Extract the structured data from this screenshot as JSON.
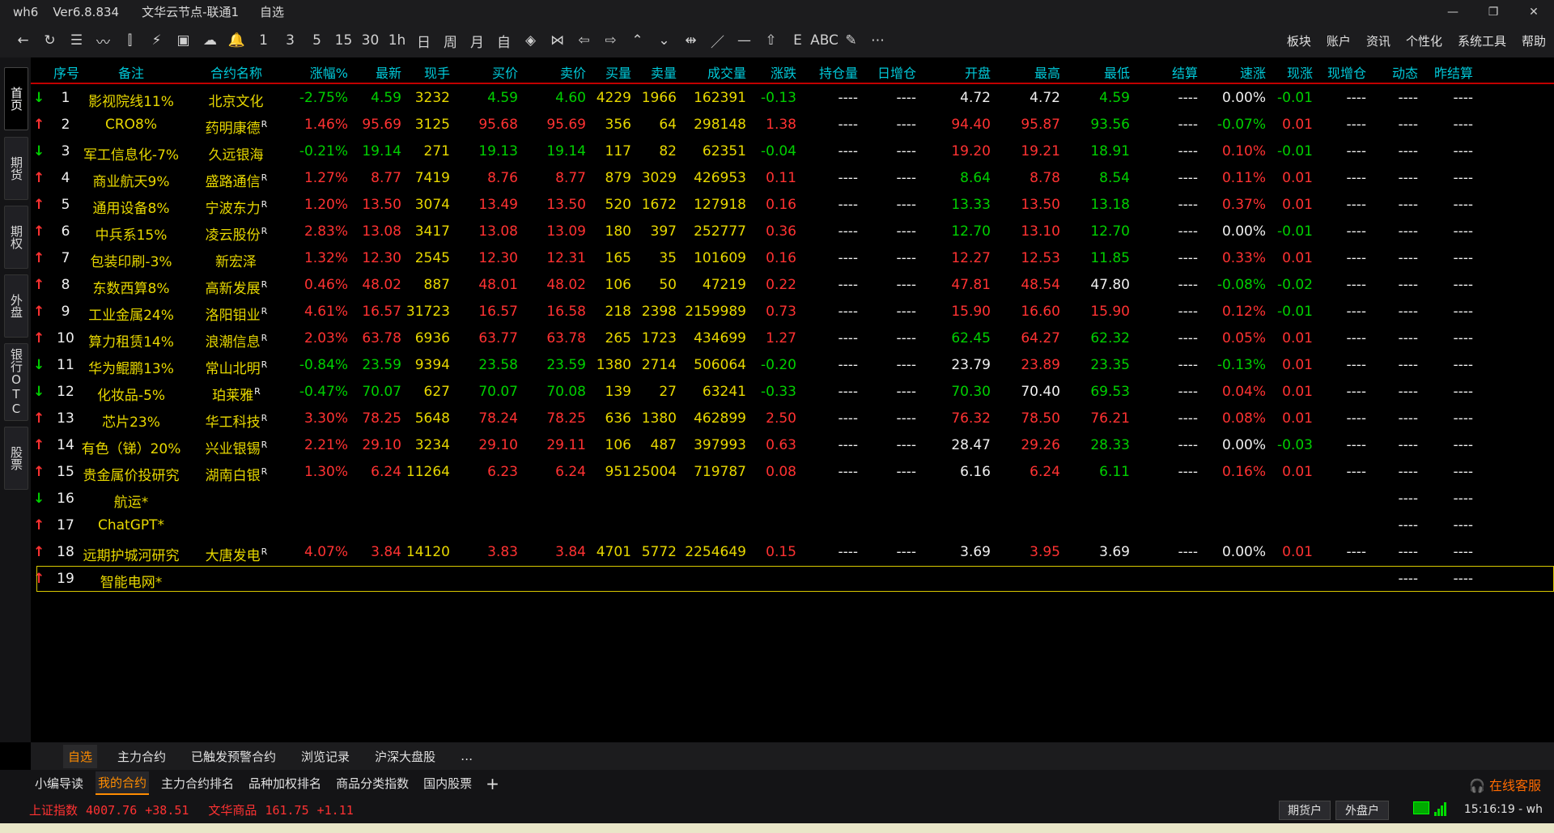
{
  "window": {
    "app": "wh6",
    "version": "Ver6.8.834",
    "node": "文华云节点-联通1",
    "page": "自选"
  },
  "toolbar": {
    "icons": [
      "back-icon",
      "refresh-icon",
      "list-icon",
      "line-chart-icon",
      "candlestick-icon",
      "lightning-chart-icon",
      "kline-box-icon",
      "cloud-lightning-icon",
      "bell-icon",
      "1",
      "3",
      "5",
      "15",
      "30",
      "1h",
      "日",
      "周",
      "月",
      "自",
      "diamond-left-icon",
      "diamond-right-icon",
      "arrow-left-icon",
      "arrow-right-icon",
      "double-up-icon",
      "double-down-icon",
      "expand-icon",
      "slash-icon",
      "dash-icon",
      "home-up-icon",
      "text-e-icon",
      "ABC",
      "pen-icon",
      "more-icon"
    ],
    "glyphs": [
      "←",
      "↻",
      "☰",
      "〰",
      "⫿",
      "⚡",
      "▣",
      "☁",
      "🔔",
      "1",
      "3",
      "5",
      "15",
      "30",
      "1h",
      "日",
      "周",
      "月",
      "自",
      "◈",
      "⋈",
      "⇦",
      "⇨",
      "⌃",
      "⌄",
      "⇹",
      "／",
      "—",
      "⇧",
      "E",
      "ABC",
      "✎",
      "⋯"
    ],
    "menu": [
      "板块",
      "账户",
      "资讯",
      "个性化",
      "系统工具",
      "帮助"
    ]
  },
  "left_tabs": [
    "首页",
    "期货",
    "期权",
    "外盘",
    "银行OTC",
    "股票"
  ],
  "table": {
    "headers": [
      "序号",
      "备注",
      "合约名称",
      "涨幅%",
      "最新",
      "现手",
      "买价",
      "卖价",
      "买量",
      "卖量",
      "成交量",
      "涨跌",
      "持仓量",
      "日增仓",
      "开盘",
      "最高",
      "最低",
      "结算",
      "速涨",
      "现涨",
      "现增仓",
      "动态",
      "昨结算"
    ],
    "rows": [
      {
        "dir": "down",
        "no": "1",
        "note": "影视院线11%",
        "name": "北京文化",
        "r": "",
        "chg_pct": "-2.75%",
        "last": "4.59",
        "cur": "3232",
        "bid": "4.59",
        "ask": "4.60",
        "bid_vol": "4229",
        "ask_vol": "1966",
        "vol": "162391",
        "chg": "-0.13",
        "oi": "----",
        "oi_chg": "----",
        "open": "4.72",
        "high": "4.72",
        "low": "4.59",
        "settle": "----",
        "speed": "0.00%",
        "cur_chg": "-0.01",
        "cur_oi": "----",
        "dyn": "----",
        "prev": "----",
        "color": "green",
        "open_c": "white",
        "high_c": "white",
        "low_c": "green",
        "speed_c": "white",
        "curchg_c": "green"
      },
      {
        "dir": "up",
        "no": "2",
        "note": "CRO8%",
        "name": "药明康德",
        "r": "R",
        "chg_pct": "1.46%",
        "last": "95.69",
        "cur": "3125",
        "bid": "95.68",
        "ask": "95.69",
        "bid_vol": "356",
        "ask_vol": "64",
        "vol": "298148",
        "chg": "1.38",
        "oi": "----",
        "oi_chg": "----",
        "open": "94.40",
        "high": "95.87",
        "low": "93.56",
        "settle": "----",
        "speed": "-0.07%",
        "cur_chg": "0.01",
        "cur_oi": "----",
        "dyn": "----",
        "prev": "----",
        "color": "red",
        "open_c": "red",
        "high_c": "red",
        "low_c": "green",
        "speed_c": "green",
        "curchg_c": "red"
      },
      {
        "dir": "down",
        "no": "3",
        "note": "军工信息化-7%",
        "name": "久远银海",
        "r": "",
        "chg_pct": "-0.21%",
        "last": "19.14",
        "cur": "271",
        "bid": "19.13",
        "ask": "19.14",
        "bid_vol": "117",
        "ask_vol": "82",
        "vol": "62351",
        "chg": "-0.04",
        "oi": "----",
        "oi_chg": "----",
        "open": "19.20",
        "high": "19.21",
        "low": "18.91",
        "settle": "----",
        "speed": "0.10%",
        "cur_chg": "-0.01",
        "cur_oi": "----",
        "dyn": "----",
        "prev": "----",
        "color": "green",
        "open_c": "red",
        "high_c": "red",
        "low_c": "green",
        "speed_c": "red",
        "curchg_c": "green"
      },
      {
        "dir": "up",
        "no": "4",
        "note": "商业航天9%",
        "name": "盛路通信",
        "r": "R",
        "chg_pct": "1.27%",
        "last": "8.77",
        "cur": "7419",
        "bid": "8.76",
        "ask": "8.77",
        "bid_vol": "879",
        "ask_vol": "3029",
        "vol": "426953",
        "chg": "0.11",
        "oi": "----",
        "oi_chg": "----",
        "open": "8.64",
        "high": "8.78",
        "low": "8.54",
        "settle": "----",
        "speed": "0.11%",
        "cur_chg": "0.01",
        "cur_oi": "----",
        "dyn": "----",
        "prev": "----",
        "color": "red",
        "open_c": "green",
        "high_c": "red",
        "low_c": "green",
        "speed_c": "red",
        "curchg_c": "red"
      },
      {
        "dir": "up",
        "no": "5",
        "note": "通用设备8%",
        "name": "宁波东力",
        "r": "R",
        "chg_pct": "1.20%",
        "last": "13.50",
        "cur": "3074",
        "bid": "13.49",
        "ask": "13.50",
        "bid_vol": "520",
        "ask_vol": "1672",
        "vol": "127918",
        "chg": "0.16",
        "oi": "----",
        "oi_chg": "----",
        "open": "13.33",
        "high": "13.50",
        "low": "13.18",
        "settle": "----",
        "speed": "0.37%",
        "cur_chg": "0.01",
        "cur_oi": "----",
        "dyn": "----",
        "prev": "----",
        "color": "red",
        "open_c": "green",
        "high_c": "red",
        "low_c": "green",
        "speed_c": "red",
        "curchg_c": "red"
      },
      {
        "dir": "up",
        "no": "6",
        "note": "中兵系15%",
        "name": "凌云股份",
        "r": "R",
        "chg_pct": "2.83%",
        "last": "13.08",
        "cur": "3417",
        "bid": "13.08",
        "ask": "13.09",
        "bid_vol": "180",
        "ask_vol": "397",
        "vol": "252777",
        "chg": "0.36",
        "oi": "----",
        "oi_chg": "----",
        "open": "12.70",
        "high": "13.10",
        "low": "12.70",
        "settle": "----",
        "speed": "0.00%",
        "cur_chg": "-0.01",
        "cur_oi": "----",
        "dyn": "----",
        "prev": "----",
        "color": "red",
        "open_c": "green",
        "high_c": "red",
        "low_c": "green",
        "speed_c": "white",
        "curchg_c": "green"
      },
      {
        "dir": "up",
        "no": "7",
        "note": "包装印刷-3%",
        "name": "新宏泽",
        "r": "",
        "chg_pct": "1.32%",
        "last": "12.30",
        "cur": "2545",
        "bid": "12.30",
        "ask": "12.31",
        "bid_vol": "165",
        "ask_vol": "35",
        "vol": "101609",
        "chg": "0.16",
        "oi": "----",
        "oi_chg": "----",
        "open": "12.27",
        "high": "12.53",
        "low": "11.85",
        "settle": "----",
        "speed": "0.33%",
        "cur_chg": "0.01",
        "cur_oi": "----",
        "dyn": "----",
        "prev": "----",
        "color": "red",
        "open_c": "red",
        "high_c": "red",
        "low_c": "green",
        "speed_c": "red",
        "curchg_c": "red"
      },
      {
        "dir": "up",
        "no": "8",
        "note": "东数西算8%",
        "name": "高新发展",
        "r": "R",
        "chg_pct": "0.46%",
        "last": "48.02",
        "cur": "887",
        "bid": "48.01",
        "ask": "48.02",
        "bid_vol": "106",
        "ask_vol": "50",
        "vol": "47219",
        "chg": "0.22",
        "oi": "----",
        "oi_chg": "----",
        "open": "47.81",
        "high": "48.54",
        "low": "47.80",
        "settle": "----",
        "speed": "-0.08%",
        "cur_chg": "-0.02",
        "cur_oi": "----",
        "dyn": "----",
        "prev": "----",
        "color": "red",
        "open_c": "red",
        "high_c": "red",
        "low_c": "white",
        "speed_c": "green",
        "curchg_c": "green"
      },
      {
        "dir": "up",
        "no": "9",
        "note": "工业金属24%",
        "name": "洛阳钼业",
        "r": "R",
        "chg_pct": "4.61%",
        "last": "16.57",
        "cur": "31723",
        "bid": "16.57",
        "ask": "16.58",
        "bid_vol": "218",
        "ask_vol": "2398",
        "vol": "2159989",
        "chg": "0.73",
        "oi": "----",
        "oi_chg": "----",
        "open": "15.90",
        "high": "16.60",
        "low": "15.90",
        "settle": "----",
        "speed": "0.12%",
        "cur_chg": "-0.01",
        "cur_oi": "----",
        "dyn": "----",
        "prev": "----",
        "color": "red",
        "open_c": "red",
        "high_c": "red",
        "low_c": "red",
        "speed_c": "red",
        "curchg_c": "green"
      },
      {
        "dir": "up",
        "no": "10",
        "note": "算力租赁14%",
        "name": "浪潮信息",
        "r": "R",
        "chg_pct": "2.03%",
        "last": "63.78",
        "cur": "6936",
        "bid": "63.77",
        "ask": "63.78",
        "bid_vol": "265",
        "ask_vol": "1723",
        "vol": "434699",
        "chg": "1.27",
        "oi": "----",
        "oi_chg": "----",
        "open": "62.45",
        "high": "64.27",
        "low": "62.32",
        "settle": "----",
        "speed": "0.05%",
        "cur_chg": "0.01",
        "cur_oi": "----",
        "dyn": "----",
        "prev": "----",
        "color": "red",
        "open_c": "green",
        "high_c": "red",
        "low_c": "green",
        "speed_c": "red",
        "curchg_c": "red"
      },
      {
        "dir": "down",
        "no": "11",
        "note": "华为鲲鹏13%",
        "name": "常山北明",
        "r": "R",
        "chg_pct": "-0.84%",
        "last": "23.59",
        "cur": "9394",
        "bid": "23.58",
        "ask": "23.59",
        "bid_vol": "1380",
        "ask_vol": "2714",
        "vol": "506064",
        "chg": "-0.20",
        "oi": "----",
        "oi_chg": "----",
        "open": "23.79",
        "high": "23.89",
        "low": "23.35",
        "settle": "----",
        "speed": "-0.13%",
        "cur_chg": "0.01",
        "cur_oi": "----",
        "dyn": "----",
        "prev": "----",
        "color": "green",
        "open_c": "white",
        "high_c": "red",
        "low_c": "green",
        "speed_c": "green",
        "curchg_c": "red"
      },
      {
        "dir": "down",
        "no": "12",
        "note": "化妆品-5%",
        "name": "珀莱雅",
        "r": "R",
        "chg_pct": "-0.47%",
        "last": "70.07",
        "cur": "627",
        "bid": "70.07",
        "ask": "70.08",
        "bid_vol": "139",
        "ask_vol": "27",
        "vol": "63241",
        "chg": "-0.33",
        "oi": "----",
        "oi_chg": "----",
        "open": "70.30",
        "high": "70.40",
        "low": "69.53",
        "settle": "----",
        "speed": "0.04%",
        "cur_chg": "0.01",
        "cur_oi": "----",
        "dyn": "----",
        "prev": "----",
        "color": "green",
        "open_c": "green",
        "high_c": "white",
        "low_c": "green",
        "speed_c": "red",
        "curchg_c": "red"
      },
      {
        "dir": "up",
        "no": "13",
        "note": "芯片23%",
        "name": "华工科技",
        "r": "R",
        "chg_pct": "3.30%",
        "last": "78.25",
        "cur": "5648",
        "bid": "78.24",
        "ask": "78.25",
        "bid_vol": "636",
        "ask_vol": "1380",
        "vol": "462899",
        "chg": "2.50",
        "oi": "----",
        "oi_chg": "----",
        "open": "76.32",
        "high": "78.50",
        "low": "76.21",
        "settle": "----",
        "speed": "0.08%",
        "cur_chg": "0.01",
        "cur_oi": "----",
        "dyn": "----",
        "prev": "----",
        "color": "red",
        "open_c": "red",
        "high_c": "red",
        "low_c": "red",
        "speed_c": "red",
        "curchg_c": "red"
      },
      {
        "dir": "up",
        "no": "14",
        "note": "有色（锑）20%",
        "name": "兴业银锡",
        "r": "R",
        "chg_pct": "2.21%",
        "last": "29.10",
        "cur": "3234",
        "bid": "29.10",
        "ask": "29.11",
        "bid_vol": "106",
        "ask_vol": "487",
        "vol": "397993",
        "chg": "0.63",
        "oi": "----",
        "oi_chg": "----",
        "open": "28.47",
        "high": "29.26",
        "low": "28.33",
        "settle": "----",
        "speed": "0.00%",
        "cur_chg": "-0.03",
        "cur_oi": "----",
        "dyn": "----",
        "prev": "----",
        "color": "red",
        "open_c": "white",
        "high_c": "red",
        "low_c": "green",
        "speed_c": "white",
        "curchg_c": "green"
      },
      {
        "dir": "up",
        "no": "15",
        "note": "贵金属价投研究",
        "name": "湖南白银",
        "r": "R",
        "chg_pct": "1.30%",
        "last": "6.24",
        "cur": "11264",
        "bid": "6.23",
        "ask": "6.24",
        "bid_vol": "951",
        "ask_vol": "25004",
        "vol": "719787",
        "chg": "0.08",
        "oi": "----",
        "oi_chg": "----",
        "open": "6.16",
        "high": "6.24",
        "low": "6.11",
        "settle": "----",
        "speed": "0.16%",
        "cur_chg": "0.01",
        "cur_oi": "----",
        "dyn": "----",
        "prev": "----",
        "color": "red",
        "open_c": "white",
        "high_c": "red",
        "low_c": "green",
        "speed_c": "red",
        "curchg_c": "red"
      },
      {
        "dir": "down",
        "no": "16",
        "note": "航运*",
        "name": "",
        "r": "",
        "chg_pct": "",
        "last": "",
        "cur": "",
        "bid": "",
        "ask": "",
        "bid_vol": "",
        "ask_vol": "",
        "vol": "",
        "chg": "",
        "oi": "",
        "oi_chg": "",
        "open": "",
        "high": "",
        "low": "",
        "settle": "",
        "speed": "",
        "cur_chg": "",
        "cur_oi": "",
        "dyn": "----",
        "prev": "----",
        "color": "green",
        "open_c": "white",
        "high_c": "white",
        "low_c": "white",
        "speed_c": "white",
        "curchg_c": "white"
      },
      {
        "dir": "up",
        "no": "17",
        "note": "ChatGPT*",
        "name": "",
        "r": "",
        "chg_pct": "",
        "last": "",
        "cur": "",
        "bid": "",
        "ask": "",
        "bid_vol": "",
        "ask_vol": "",
        "vol": "",
        "chg": "",
        "oi": "",
        "oi_chg": "",
        "open": "",
        "high": "",
        "low": "",
        "settle": "",
        "speed": "",
        "cur_chg": "",
        "cur_oi": "",
        "dyn": "----",
        "prev": "----",
        "color": "red",
        "open_c": "white",
        "high_c": "white",
        "low_c": "white",
        "speed_c": "white",
        "curchg_c": "white"
      },
      {
        "dir": "up",
        "no": "18",
        "note": "远期护城河研究",
        "name": "大唐发电",
        "r": "R",
        "chg_pct": "4.07%",
        "last": "3.84",
        "cur": "14120",
        "bid": "3.83",
        "ask": "3.84",
        "bid_vol": "4701",
        "ask_vol": "5772",
        "vol": "2254649",
        "chg": "0.15",
        "oi": "----",
        "oi_chg": "----",
        "open": "3.69",
        "high": "3.95",
        "low": "3.69",
        "settle": "----",
        "speed": "0.00%",
        "cur_chg": "0.01",
        "cur_oi": "----",
        "dyn": "----",
        "prev": "----",
        "color": "red",
        "open_c": "white",
        "high_c": "red",
        "low_c": "white",
        "speed_c": "white",
        "curchg_c": "red"
      },
      {
        "dir": "up",
        "no": "19",
        "note": "智能电网*",
        "name": "",
        "r": "",
        "chg_pct": "",
        "last": "",
        "cur": "",
        "bid": "",
        "ask": "",
        "bid_vol": "",
        "ask_vol": "",
        "vol": "",
        "chg": "",
        "oi": "",
        "oi_chg": "",
        "open": "",
        "high": "",
        "low": "",
        "settle": "",
        "speed": "",
        "cur_chg": "",
        "cur_oi": "",
        "dyn": "----",
        "prev": "----",
        "color": "red",
        "open_c": "white",
        "high_c": "white",
        "low_c": "white",
        "speed_c": "white",
        "curchg_c": "white"
      }
    ]
  },
  "sheet_tabs": [
    "自选",
    "主力合约",
    "已触发预警合约",
    "浏览记录",
    "沪深大盘股",
    "…"
  ],
  "bottom_tabs": [
    "小编导读",
    "我的合约",
    "主力合约排名",
    "品种加权排名",
    "商品分类指数",
    "国内股票"
  ],
  "bottom_plus": "+",
  "service": "在线客服",
  "status": {
    "idx1_name": "上证指数",
    "idx1_val": "4007.76",
    "idx1_chg": "+38.51",
    "idx2_name": "文华商品",
    "idx2_val": "161.75",
    "idx2_chg": "+1.11",
    "btn_futures": "期货户",
    "btn_foreign": "外盘户",
    "clock": "15:16:19 - wh"
  },
  "colors": {
    "up": "#ff3232",
    "down": "#00d000",
    "header": "#00c8d8",
    "accent": "#ff8c00",
    "select": "#d8c800"
  }
}
